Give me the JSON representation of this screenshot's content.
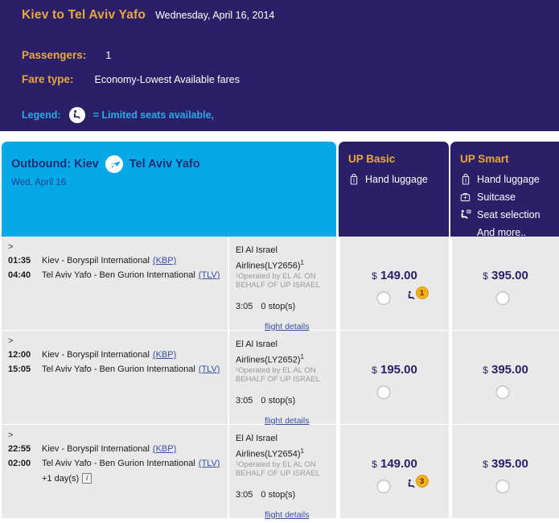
{
  "summary": {
    "route_title": "Kiev to Tel Aviv Yafo",
    "route_date": "Wednesday, April 16, 2014",
    "passengers_label": "Passengers",
    "passengers_colon": ":",
    "passengers_value": "1",
    "fare_type_label": "Fare type",
    "fare_type_colon": ":",
    "fare_type_value": "Economy-Lowest Available fares",
    "legend_label": "Legend:",
    "legend_icon": "limited-seat-icon",
    "legend_text": "= Limited seats available,"
  },
  "colors": {
    "navy": "#2b2068",
    "gold": "#e8a93c",
    "cyan": "#05a9e8",
    "legend_blue": "#2ea8e8",
    "row_gray": "#e9e9e9",
    "badge_orange": "#f2b01e",
    "link_blue": "#3a4fa0"
  },
  "outbound_header": {
    "title_prefix": "Outbound: Kiev",
    "plane_icon": "airplane-icon",
    "destination": "Tel Aviv Yafo",
    "date": "Wed, April 16"
  },
  "fare_columns": [
    {
      "name": "UP Basic",
      "perks": [
        {
          "icon": "hand-luggage-icon",
          "label": "Hand luggage"
        }
      ],
      "more_label": ""
    },
    {
      "name": "UP Smart",
      "perks": [
        {
          "icon": "hand-luggage-icon",
          "label": "Hand luggage"
        },
        {
          "icon": "suitcase-icon",
          "label": "Suitcase"
        },
        {
          "icon": "seat-selection-icon",
          "label": "Seat selection"
        }
      ],
      "more_label": "And more.."
    }
  ],
  "flights": [
    {
      "expand_caret": ">",
      "depart_time": "01:35",
      "depart_place": "Kiev - Boryspil International",
      "depart_code": "(KBP)",
      "arrive_time": "04:40",
      "arrive_place": "Tel Aviv Yafo - Ben Gurion International",
      "arrive_code": "(TLV)",
      "plus_days": "",
      "airline_name": "El Al Israel",
      "airline_flight": "Airlines(LY2656)",
      "airline_sup": "1",
      "operated_note": "¹Operated by EL AL ON BEHALF OF UP ISRAEL",
      "duration": "3:05",
      "stops": "0 stop(s)",
      "details_link": "flight details",
      "basic_price": "149.00",
      "basic_currency": "$",
      "basic_seats_left": "1",
      "smart_price": "395.00",
      "smart_currency": "$",
      "smart_seats_left": ""
    },
    {
      "expand_caret": ">",
      "depart_time": "12:00",
      "depart_place": "Kiev - Boryspil International",
      "depart_code": "(KBP)",
      "arrive_time": "15:05",
      "arrive_place": "Tel Aviv Yafo - Ben Gurion International",
      "arrive_code": "(TLV)",
      "plus_days": "",
      "airline_name": "El Al Israel",
      "airline_flight": "Airlines(LY2652)",
      "airline_sup": "1",
      "operated_note": "¹Operated by EL AL ON BEHALF OF UP ISRAEL",
      "duration": "3:05",
      "stops": "0 stop(s)",
      "details_link": "flight details",
      "basic_price": "195.00",
      "basic_currency": "$",
      "basic_seats_left": "",
      "smart_price": "395.00",
      "smart_currency": "$",
      "smart_seats_left": ""
    },
    {
      "expand_caret": ">",
      "depart_time": "22:55",
      "depart_place": "Kiev - Boryspil International",
      "depart_code": "(KBP)",
      "arrive_time": "02:00",
      "arrive_place": "Tel Aviv Yafo - Ben Gurion International",
      "arrive_code": "(TLV)",
      "plus_days": "+1 day(s)",
      "airline_name": "El Al Israel",
      "airline_flight": "Airlines(LY2654)",
      "airline_sup": "1",
      "operated_note": "¹Operated by EL AL ON BEHALF OF UP ISRAEL",
      "duration": "3:05",
      "stops": "0 stop(s)",
      "details_link": "flight details",
      "basic_price": "149.00",
      "basic_currency": "$",
      "basic_seats_left": "3",
      "smart_price": "395.00",
      "smart_currency": "$",
      "smart_seats_left": ""
    }
  ]
}
